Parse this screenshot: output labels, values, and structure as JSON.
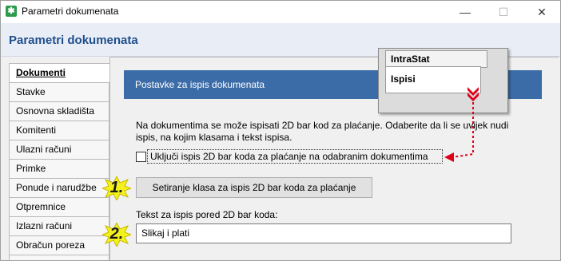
{
  "window": {
    "title": "Parametri dokumenata",
    "minimize_glyph": "—",
    "maximize_glyph": "☐",
    "close_glyph": "✕"
  },
  "header": {
    "title": "Parametri dokumenata"
  },
  "sidebar": {
    "items": [
      {
        "label": "Dokumenti",
        "active": true
      },
      {
        "label": "Stavke",
        "active": false
      },
      {
        "label": "Osnovna skladišta",
        "active": false
      },
      {
        "label": "Komitenti",
        "active": false
      },
      {
        "label": "Ulazni računi",
        "active": false
      },
      {
        "label": "Primke",
        "active": false
      },
      {
        "label": "Ponude i narudžbe",
        "active": false
      },
      {
        "label": "Otpremnice",
        "active": false
      },
      {
        "label": "Izlazni računi",
        "active": false
      },
      {
        "label": "Obračun poreza",
        "active": false
      }
    ]
  },
  "zoom_callout": {
    "tab_intrastat": "IntraStat",
    "tab_ispisi": "Ispisi"
  },
  "section": {
    "title": "Postavke za ispis dokumenata",
    "description_line1": "Na dokumentima se može ispisati 2D bar kod za plaćanje. Odaberite da li se uvijek nudi",
    "description_line2": "ispis, na kojim klasama i tekst ispisa.",
    "checkbox_label": "Uključi ispis 2D bar koda za plaćanje na odabranim dokumentima",
    "checkbox_checked": false,
    "setup_button_label": "Setiranje klasa za ispis 2D bar koda za plaćanje",
    "text_field_label": "Tekst za ispis pored 2D bar koda:",
    "text_field_value": "Slikaj i plati"
  },
  "annotations": {
    "step1": "1.",
    "step2": "2.",
    "badge_color": "#f4f21c",
    "arrow_color": "#e0001a"
  },
  "colors": {
    "section_bar": "#3c6ca8",
    "header_title": "#1f4e8c",
    "app_icon": "#2e9b4c"
  }
}
